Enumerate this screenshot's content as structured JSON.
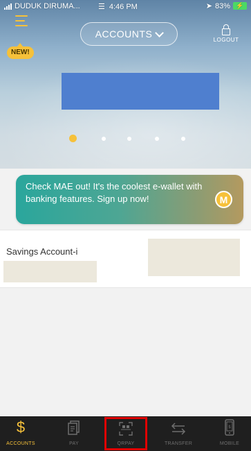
{
  "status_bar": {
    "carrier": "DUDUK DIRUMA...",
    "time": "4:46 PM",
    "battery": "83%"
  },
  "header": {
    "new_badge": "NEW!",
    "title": "ACCOUNTS",
    "logout_label": "LOGOUT"
  },
  "carousel": {
    "dot_count": 5,
    "active_index": 0
  },
  "promo": {
    "text": "Check MAE out! It's the coolest e-wallet with banking features. Sign up now!",
    "icon_letter": "M"
  },
  "accounts": [
    {
      "name": "Savings Account-i"
    }
  ],
  "bottom_nav": {
    "items": [
      {
        "label": "ACCOUNTS",
        "icon": "dollar-icon",
        "active": true
      },
      {
        "label": "PAY",
        "icon": "bill-icon",
        "active": false
      },
      {
        "label": "QRPAY",
        "icon": "qr-scan-icon",
        "active": false
      },
      {
        "label": "TRANSFER",
        "icon": "transfer-arrows-icon",
        "active": false
      },
      {
        "label": "MOBILE",
        "icon": "mobile-phone-icon",
        "active": false
      }
    ]
  },
  "colors": {
    "accent": "#f6c13a",
    "nav_background": "#1f1f1f",
    "highlight": "#e00000"
  }
}
